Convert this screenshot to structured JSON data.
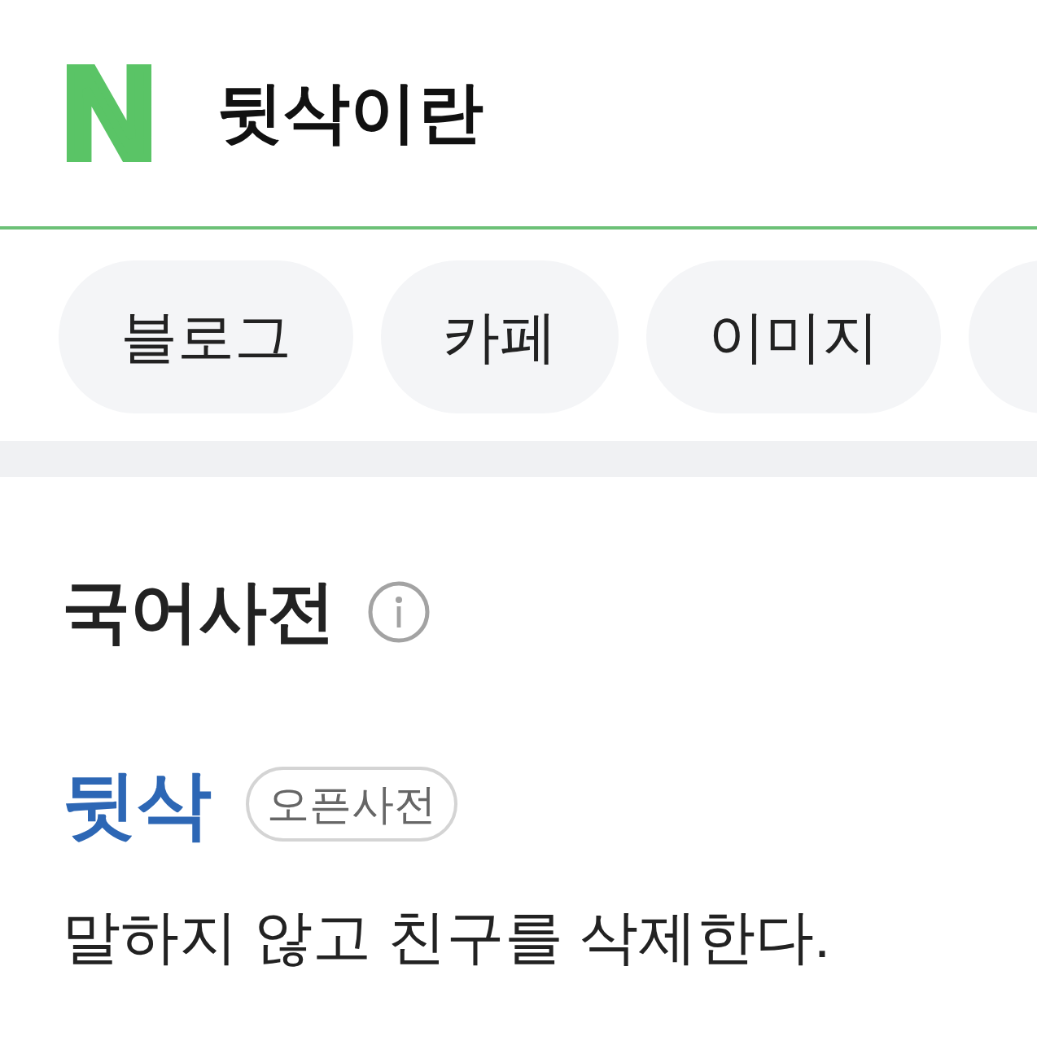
{
  "search_bar": {
    "logo": "N",
    "query": "뒷삭이란"
  },
  "tabs": [
    "블로그",
    "카페",
    "이미지"
  ],
  "dictionary": {
    "title": "국어사전",
    "entries": [
      {
        "word": "뒷삭",
        "badge": "오픈사전",
        "definition": "말하지 않고 친구를 삭제한다."
      }
    ]
  }
}
